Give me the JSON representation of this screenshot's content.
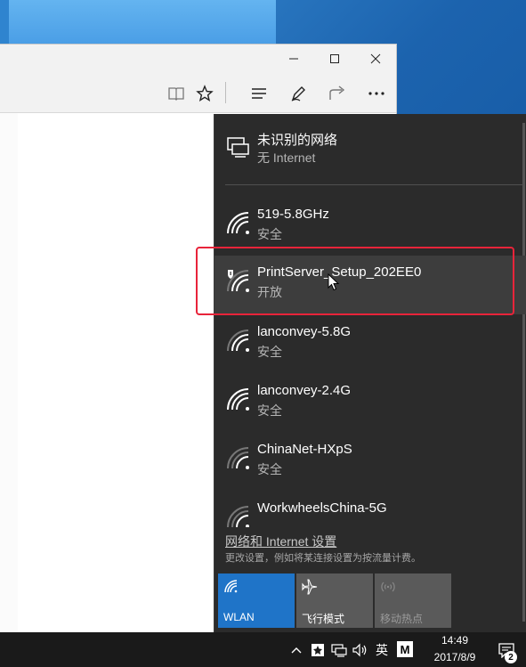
{
  "colors": {
    "flyout_bg": "#2b2b2b",
    "accent": "#1f74c8",
    "tile_inactive": "#5a5a5a",
    "highlight_border": "#e8243a"
  },
  "browser": {
    "window_controls": [
      "minimize-icon",
      "maximize-icon",
      "close-icon"
    ],
    "toolbar_icons": [
      "reading-view-icon",
      "favorite-star-icon",
      "hub-icon",
      "web-note-icon",
      "share-icon",
      "more-icon"
    ]
  },
  "network": {
    "current": {
      "name": "未识别的网络",
      "status": "无 Internet",
      "icon": "ethernet-icon"
    },
    "wifi": [
      {
        "name": "519-5.8GHz",
        "status": "安全",
        "icon": "wifi-icon"
      },
      {
        "name": "PrintServer_Setup_202EE0",
        "status": "开放",
        "icon": "wifi-open-icon"
      },
      {
        "name": "lanconvey-5.8G",
        "status": "安全",
        "icon": "wifi-icon"
      },
      {
        "name": "lanconvey-2.4G",
        "status": "安全",
        "icon": "wifi-icon"
      },
      {
        "name": "ChinaNet-HXpS",
        "status": "安全",
        "icon": "wifi-icon"
      },
      {
        "name": "WorkwheelsChina-5G",
        "status": "",
        "icon": "wifi-icon"
      }
    ],
    "settings_link": "网络和 Internet 设置",
    "settings_desc": "更改设置，例如将某连接设置为按流量计费。",
    "tiles": [
      {
        "label": "WLAN",
        "icon": "wifi-icon",
        "active": true
      },
      {
        "label": "飞行模式",
        "icon": "airplane-icon",
        "active": false
      },
      {
        "label": "移动热点",
        "icon": "hotspot-icon",
        "active": false,
        "disabled": true
      }
    ]
  },
  "taskbar": {
    "time": "14:49",
    "date": "2017/8/9",
    "ime_lang": "英",
    "ime_mode": "M",
    "notification_count": "2",
    "tray_icons": [
      "chevron-up-icon",
      "app-tray-icon",
      "network-icon",
      "volume-icon"
    ]
  }
}
